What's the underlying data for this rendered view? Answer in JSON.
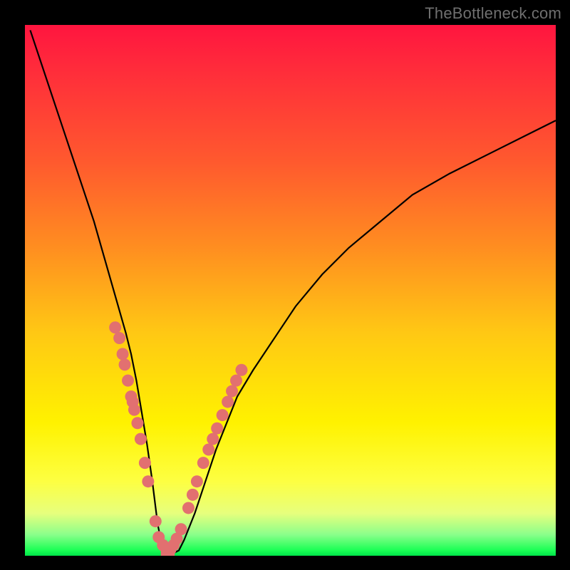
{
  "watermark": "TheBottleneck.com",
  "chart_data": {
    "type": "line",
    "title": "",
    "xlabel": "",
    "ylabel": "",
    "xlim": [
      0,
      100
    ],
    "ylim": [
      0,
      100
    ],
    "curve": {
      "x": [
        1,
        3,
        5,
        7,
        9,
        11,
        13,
        15,
        17,
        19,
        20,
        21,
        22,
        23,
        24,
        25,
        26,
        27,
        28,
        29,
        30,
        32,
        34,
        36,
        38,
        40,
        43,
        47,
        51,
        56,
        61,
        67,
        73,
        80,
        88,
        96,
        100
      ],
      "y": [
        99,
        93,
        87,
        81,
        75,
        69,
        63,
        56,
        49,
        42,
        38,
        33,
        27,
        21,
        14,
        6,
        1,
        0.5,
        0.5,
        1,
        3,
        8,
        14,
        20,
        25,
        30,
        35,
        41,
        47,
        53,
        58,
        63,
        68,
        72,
        76,
        80,
        82
      ]
    },
    "left_markers": {
      "x": [
        17.0,
        17.8,
        18.4,
        18.8,
        19.4,
        20.0,
        20.3,
        20.6,
        21.2,
        21.8,
        22.6,
        23.2,
        24.6,
        25.2,
        26.0,
        26.8
      ],
      "y": [
        43.0,
        41.0,
        38.0,
        36.0,
        33.0,
        30.0,
        29.0,
        27.5,
        25.0,
        22.0,
        17.5,
        14.0,
        6.5,
        3.5,
        2.0,
        1.2
      ]
    },
    "right_markers": {
      "x": [
        27.4,
        28.0,
        28.6,
        29.4,
        30.8,
        31.6,
        32.4,
        33.6,
        34.6,
        35.4,
        36.2,
        37.2,
        38.2,
        39.0,
        39.8,
        40.8
      ],
      "y": [
        1.2,
        2.0,
        3.2,
        5.0,
        9.0,
        11.5,
        14.0,
        17.5,
        20.0,
        22.0,
        24.0,
        26.5,
        29.0,
        31.0,
        33.0,
        35.0
      ]
    },
    "bottom_bar": {
      "x0": 25.6,
      "x1": 28.2,
      "y": 0.4,
      "thickness": 1.4
    },
    "marker_color": "#e27070",
    "curve_color": "#000000"
  }
}
